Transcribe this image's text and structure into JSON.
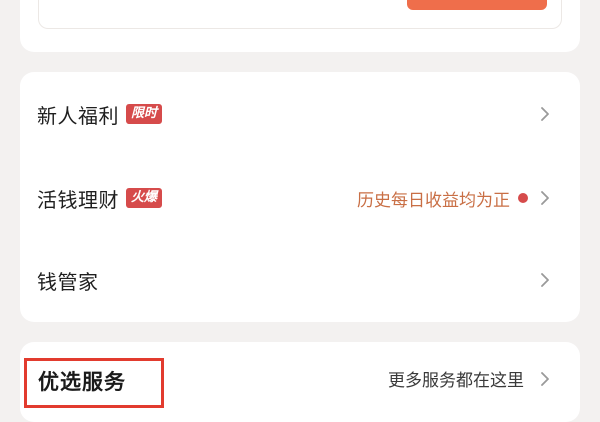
{
  "menu": {
    "items": [
      {
        "label": "新人福利",
        "badge": "限时"
      },
      {
        "label": "活钱理财",
        "badge": "火爆",
        "hint": "历史每日收益均为正"
      },
      {
        "label": "钱管家"
      }
    ]
  },
  "services": {
    "title": "优选服务",
    "more_label": "更多服务都在这里"
  },
  "colors": {
    "accent": "#ef6e4b",
    "badge": "#d64b4b",
    "hint": "#c96f45",
    "highlight_box": "#e23b2e"
  }
}
